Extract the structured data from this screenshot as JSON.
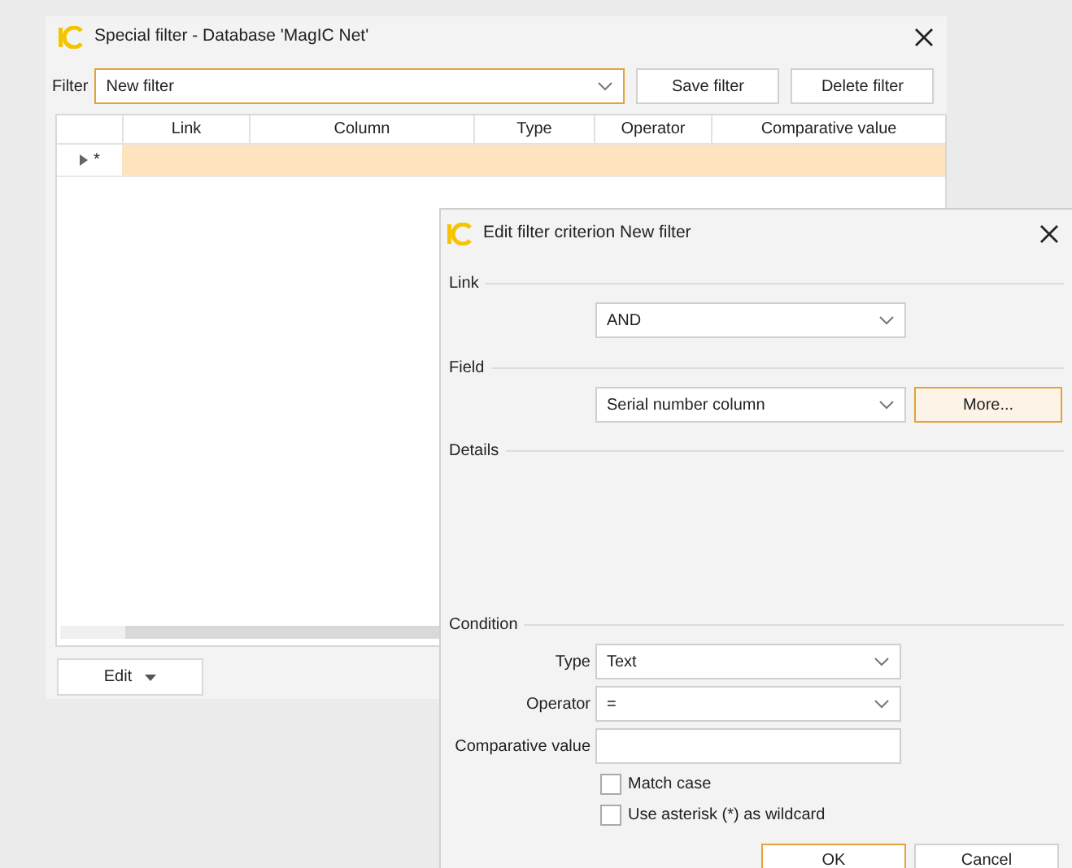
{
  "main_window": {
    "title": "Special filter - Database 'MagIC Net'",
    "filter_label": "Filter",
    "filter_value": "New filter",
    "buttons": [
      "Save filter",
      "Delete filter"
    ],
    "table": {
      "columns": [
        "Link",
        "Column",
        "Type",
        "Operator",
        "Comparative value"
      ],
      "rows": [
        {
          "indicator": "*",
          "selected": true
        }
      ]
    },
    "edit_button": "Edit"
  },
  "dialog": {
    "title": "Edit filter criterion New filter",
    "link_label": "Link",
    "link_value": "AND",
    "field_label": "Field",
    "field_value": "Serial number column",
    "more_button": "More...",
    "details_label": "Details",
    "condition_label": "Condition",
    "rows": [
      {
        "label": "Type",
        "kind": "dropdown",
        "value": "Text"
      },
      {
        "label": "Operator",
        "kind": "dropdown",
        "value": "="
      },
      {
        "label": "Comparative value",
        "kind": "text"
      }
    ],
    "checkboxes": [
      {
        "label": "Match case",
        "checked": false
      },
      {
        "label": "Use asterisk (*) as wildcard",
        "checked": false
      }
    ],
    "buttons": [
      {
        "label": "OK",
        "default": true
      },
      {
        "label": "Cancel",
        "default": false
      }
    ]
  }
}
